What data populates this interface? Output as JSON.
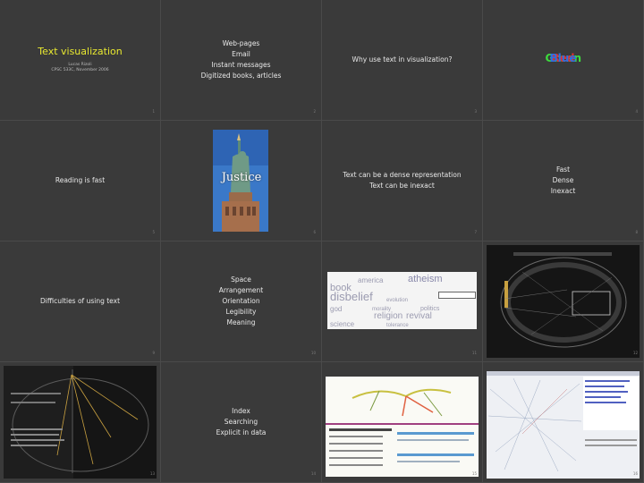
{
  "slides": [
    {
      "kind": "title",
      "title": "Text visualization",
      "author": "Lucas Rizoli",
      "course": "CPSC 533C, November 2006",
      "number": "1"
    },
    {
      "kind": "list",
      "lines": [
        "Web-pages",
        "Email",
        "Instant messages",
        "Digitized books, articles"
      ],
      "number": "2"
    },
    {
      "kind": "text",
      "text": "Why use text in visualization?",
      "number": "3"
    },
    {
      "kind": "stroop",
      "words": [
        "Green",
        "Red",
        "Blue"
      ],
      "colors": [
        "#3ddc3d",
        "#e03030",
        "#2f6fe0"
      ],
      "number": "4"
    },
    {
      "kind": "text",
      "text": "Reading is fast",
      "number": "5"
    },
    {
      "kind": "image",
      "overlay_text": "Justice",
      "number": "6"
    },
    {
      "kind": "list",
      "lines": [
        "Text can be a dense representation",
        "Text can be inexact"
      ],
      "number": "7"
    },
    {
      "kind": "list",
      "lines": [
        "Fast",
        "Dense",
        "Inexact"
      ],
      "number": "8"
    },
    {
      "kind": "text",
      "text": "Difficulties of using text",
      "number": "9"
    },
    {
      "kind": "list",
      "lines": [
        "Space",
        "Arrangement",
        "Orientation",
        "Legibility",
        "Meaning"
      ],
      "number": "10"
    },
    {
      "kind": "tagcloud",
      "words": [
        "atheism",
        "america",
        "book",
        "disbelief",
        "god",
        "religion",
        "revival",
        "science",
        "politics",
        "evolution",
        "tolerance",
        "morality"
      ],
      "number": "11"
    },
    {
      "kind": "screenshot",
      "number": "12"
    },
    {
      "kind": "screenshot",
      "number": "13"
    },
    {
      "kind": "list",
      "lines": [
        "Index",
        "Searching",
        "Explicit in data"
      ],
      "number": "14"
    },
    {
      "kind": "screenshot",
      "number": "15"
    },
    {
      "kind": "screenshot",
      "number": "16"
    }
  ]
}
